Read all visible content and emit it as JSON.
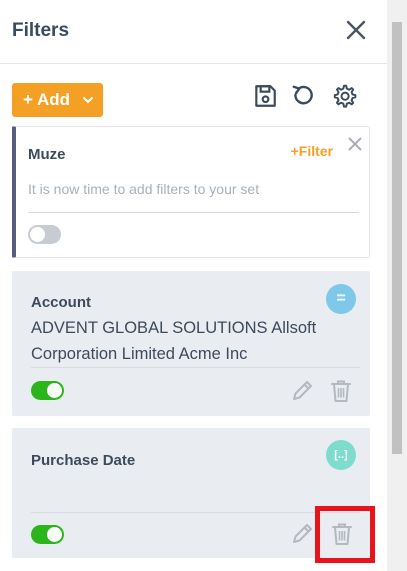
{
  "header": {
    "title": "Filters",
    "close_icon": "close-icon"
  },
  "toolbar": {
    "add_label": "+ Add",
    "icons": [
      "save-icon",
      "reset-icon",
      "settings-icon"
    ]
  },
  "filter_set": {
    "name": "Muze",
    "add_filter_label": "+Filter",
    "empty_message": "It is now time to add filters to your set",
    "enabled": false
  },
  "filters": [
    {
      "name": "Account",
      "value": "ADVENT GLOBAL SOLUTIONS Allsoft Corporation Limited Acme Inc",
      "operator_symbol": "=",
      "enabled": true
    },
    {
      "name": "Purchase Date",
      "value": "",
      "operator_symbol": "[..]",
      "enabled": true
    }
  ],
  "colors": {
    "accent": "#f4a025",
    "toggle_on": "#2bb51a",
    "toggle_off": "#c7ccd3",
    "highlight": "#e8141c"
  }
}
